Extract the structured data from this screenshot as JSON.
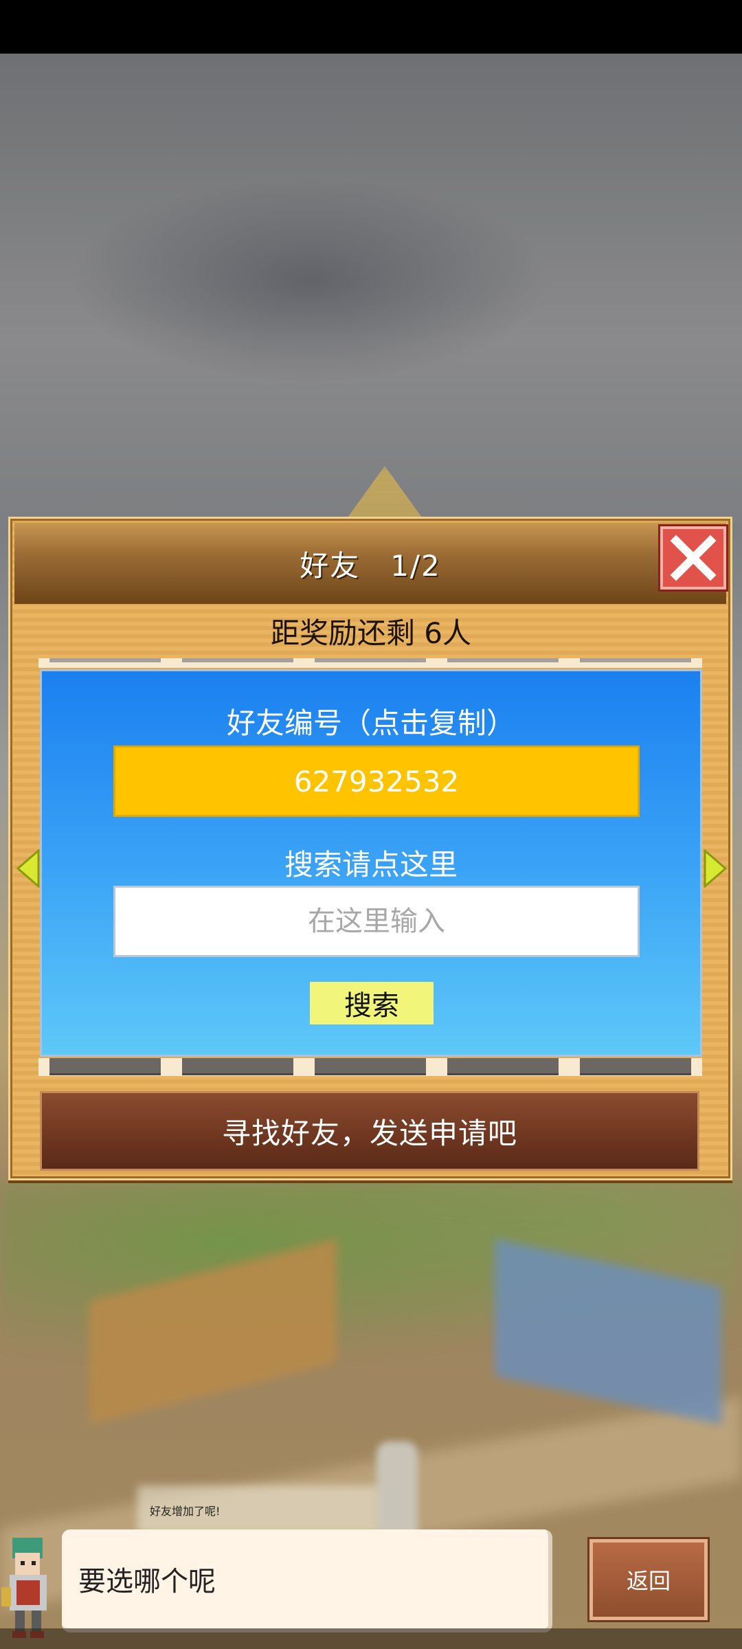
{
  "dialog": {
    "title": "好友　1/2",
    "reward_text": "距奖励还剩 6人"
  },
  "friend_panel": {
    "id_label": "好友编号（点击复制）",
    "friend_id": "627932532",
    "search_label": "搜索请点这里",
    "search_placeholder": "在这里输入",
    "search_button": "搜索"
  },
  "find_friends_button": "寻找好友，发送申请吧",
  "toast": "好友增加了呢!",
  "speech": "要选哪个呢",
  "back_button": "返回",
  "colors": {
    "panel_blue": "#1a80f0",
    "id_box_yellow": "#ffc300",
    "search_button": "#f1f57a",
    "close_red": "#e0524a",
    "dialog_wood": "#e9b15a"
  },
  "icons": [
    "close-icon",
    "arrow-left-icon",
    "arrow-right-icon"
  ]
}
